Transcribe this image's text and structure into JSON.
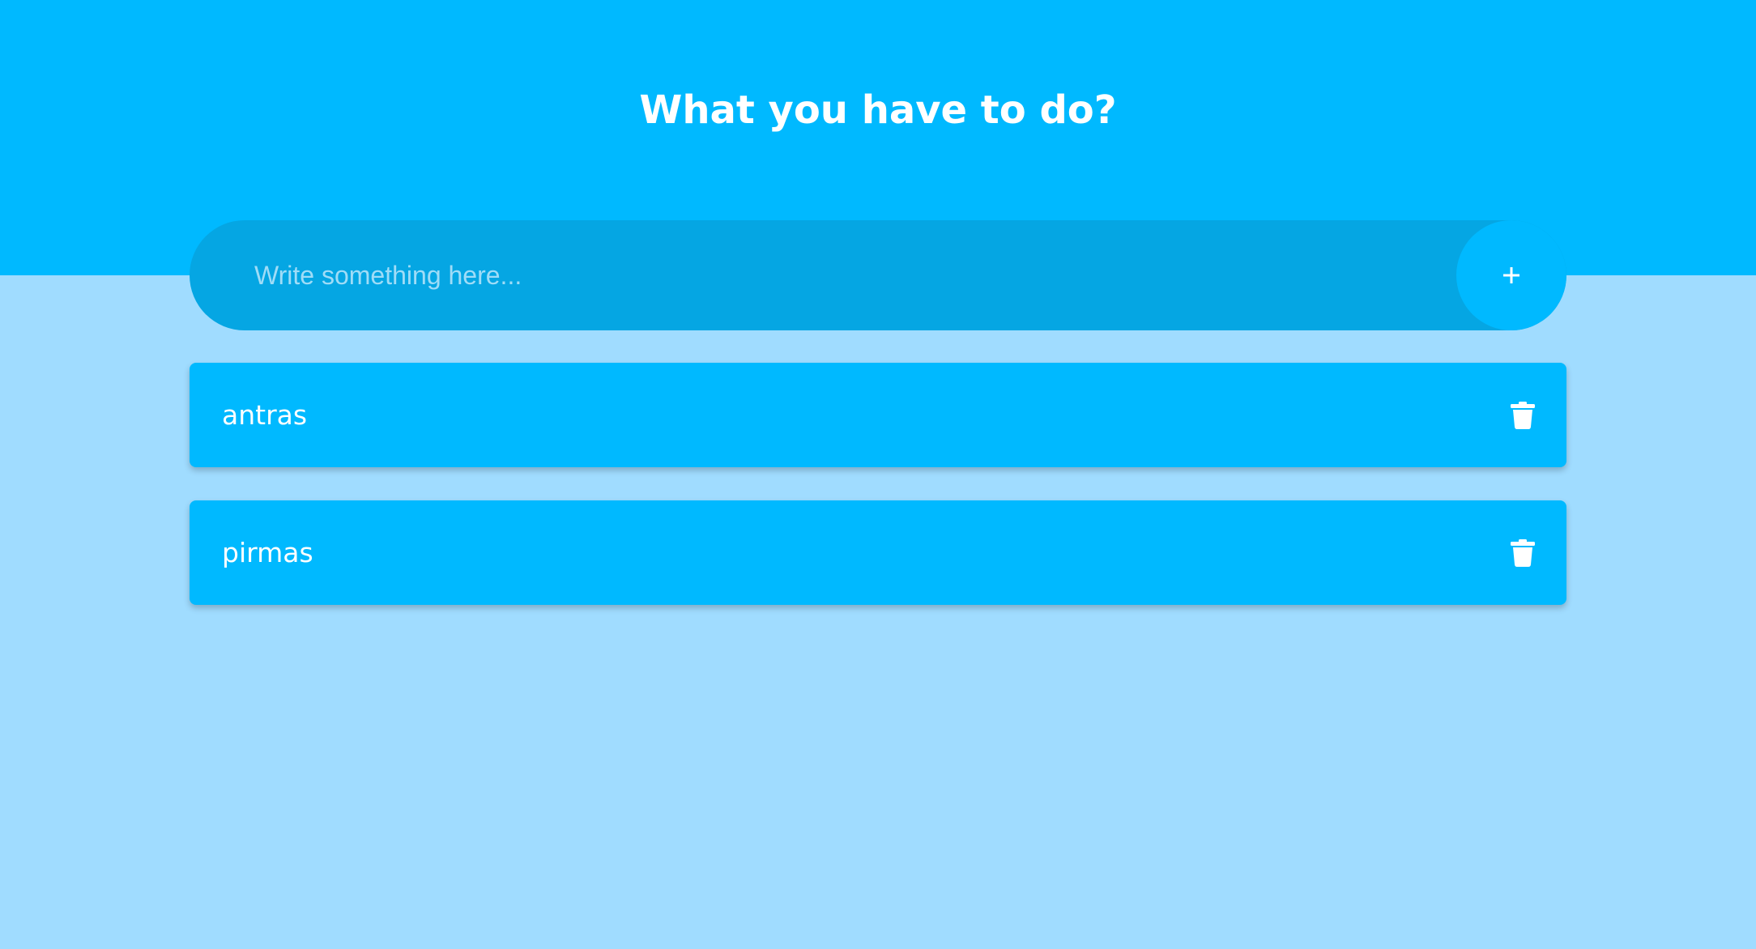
{
  "header": {
    "title": "What you have to do?",
    "background_color": "#00b9ff"
  },
  "add_bar": {
    "placeholder": "Write something here...",
    "value": "",
    "add_icon": "plus-icon"
  },
  "todos": [
    {
      "text": "antras",
      "delete_icon": "trash-icon"
    },
    {
      "text": "pirmas",
      "delete_icon": "trash-icon"
    }
  ],
  "colors": {
    "page_background": "#a0dcff",
    "accent": "#00b9ff",
    "input_background": "#05a6e3",
    "text": "#ffffff"
  }
}
